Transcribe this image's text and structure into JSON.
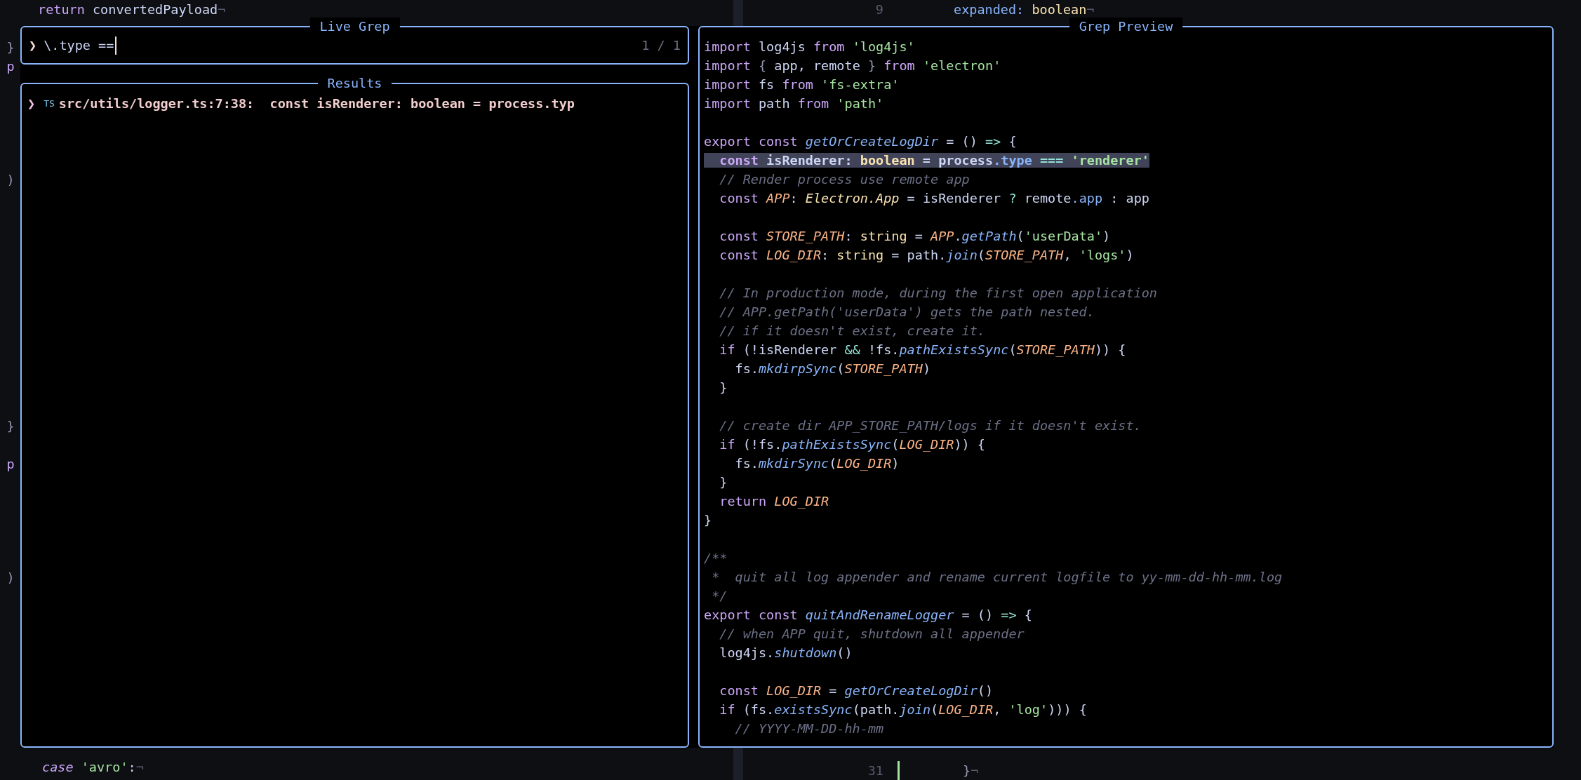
{
  "editor": {
    "top_left_line": [
      {
        "kind": "keyword",
        "text": "return"
      },
      {
        "kind": "plain",
        "text": " convertedPayload"
      },
      {
        "kind": "eol",
        "text": "¬"
      }
    ],
    "top_right_line": {
      "number": "9",
      "tokens": [
        {
          "kind": "property",
          "text": "expanded: "
        },
        {
          "kind": "type",
          "text": "boolean"
        },
        {
          "kind": "eol",
          "text": "¬"
        }
      ]
    },
    "left_edge_glyphs": [
      {
        "text": "}",
        "kind": "punct"
      },
      {
        "text": "p",
        "kind": "keyword"
      },
      {
        "text": ")",
        "kind": "punct"
      },
      {
        "text": "}",
        "kind": "punct"
      },
      {
        "text": "p",
        "kind": "keyword"
      },
      {
        "text": ")",
        "kind": "punct"
      }
    ],
    "bottom_left_line": [
      {
        "kind": "keyword-italic",
        "text": "case "
      },
      {
        "kind": "string",
        "text": "'avro'"
      },
      {
        "kind": "plain",
        "text": ":"
      },
      {
        "kind": "eol",
        "text": "¬"
      }
    ],
    "bottom_right_line": {
      "number": "31",
      "tokens": [
        {
          "kind": "punct",
          "text": "}"
        },
        {
          "kind": "eol",
          "text": "¬"
        }
      ]
    }
  },
  "prompt": {
    "title": "Live Grep",
    "caret": "❯",
    "value": "\\.type ==",
    "counter": "1 / 1"
  },
  "results": {
    "title": "Results",
    "items": [
      {
        "selected": true,
        "caret": "❯",
        "filetype": "TS",
        "path": "src/utils/logger.ts:7:38:",
        "text": "  const isRenderer: boolean = process.typ"
      }
    ]
  },
  "preview": {
    "title": "Grep Preview",
    "lines": [
      {
        "selected": false,
        "tokens": [
          {
            "kind": "keyword",
            "text": "import"
          },
          {
            "kind": "plain",
            "text": " log4js "
          },
          {
            "kind": "keyword",
            "text": "from "
          },
          {
            "kind": "string",
            "text": "'log4js'"
          }
        ]
      },
      {
        "selected": false,
        "tokens": [
          {
            "kind": "keyword",
            "text": "import"
          },
          {
            "kind": "punct",
            "text": " { "
          },
          {
            "kind": "plain",
            "text": "app, remote"
          },
          {
            "kind": "punct",
            "text": " } "
          },
          {
            "kind": "keyword",
            "text": "from "
          },
          {
            "kind": "string",
            "text": "'electron'"
          }
        ]
      },
      {
        "selected": false,
        "tokens": [
          {
            "kind": "keyword",
            "text": "import"
          },
          {
            "kind": "plain",
            "text": " fs "
          },
          {
            "kind": "keyword",
            "text": "from "
          },
          {
            "kind": "string",
            "text": "'fs-extra'"
          }
        ]
      },
      {
        "selected": false,
        "tokens": [
          {
            "kind": "keyword",
            "text": "import"
          },
          {
            "kind": "plain",
            "text": " path "
          },
          {
            "kind": "keyword",
            "text": "from "
          },
          {
            "kind": "string",
            "text": "'path'"
          }
        ]
      },
      {
        "selected": false
      },
      {
        "selected": false,
        "tokens": [
          {
            "kind": "keyword",
            "text": "export const "
          },
          {
            "kind": "function",
            "text": "getOrCreateLogDir"
          },
          {
            "kind": "plain",
            "text": " = () "
          },
          {
            "kind": "operator",
            "text": "=>"
          },
          {
            "kind": "plain",
            "text": " {"
          }
        ]
      },
      {
        "selected": true,
        "tokens": [
          {
            "kind": "keyword",
            "text": "  const"
          },
          {
            "kind": "plain",
            "text": " isRenderer: "
          },
          {
            "kind": "type",
            "text": "boolean"
          },
          {
            "kind": "plain",
            "text": " = process"
          },
          {
            "kind": "property",
            "text": ".type "
          },
          {
            "kind": "operator",
            "text": "=== "
          },
          {
            "kind": "string",
            "text": "'renderer'"
          }
        ]
      },
      {
        "selected": false,
        "tokens": [
          {
            "kind": "comment",
            "text": "  // Render process use remote app"
          }
        ]
      },
      {
        "selected": false,
        "tokens": [
          {
            "kind": "keyword",
            "text": "  const "
          },
          {
            "kind": "constant",
            "text": "APP"
          },
          {
            "kind": "plain",
            "text": ": "
          },
          {
            "kind": "type-italic",
            "text": "Electron.App"
          },
          {
            "kind": "plain",
            "text": " = isRenderer "
          },
          {
            "kind": "operator",
            "text": "?"
          },
          {
            "kind": "plain",
            "text": " remote"
          },
          {
            "kind": "property",
            "text": ".app"
          },
          {
            "kind": "plain",
            "text": " : app"
          }
        ]
      },
      {
        "selected": false
      },
      {
        "selected": false,
        "tokens": [
          {
            "kind": "keyword",
            "text": "  const "
          },
          {
            "kind": "constant",
            "text": "STORE_PATH"
          },
          {
            "kind": "plain",
            "text": ": "
          },
          {
            "kind": "type",
            "text": "string"
          },
          {
            "kind": "plain",
            "text": " = "
          },
          {
            "kind": "constant",
            "text": "APP"
          },
          {
            "kind": "plain",
            "text": "."
          },
          {
            "kind": "function",
            "text": "getPath"
          },
          {
            "kind": "plain",
            "text": "("
          },
          {
            "kind": "string",
            "text": "'userData'"
          },
          {
            "kind": "plain",
            "text": ")"
          }
        ]
      },
      {
        "selected": false,
        "tokens": [
          {
            "kind": "keyword",
            "text": "  const "
          },
          {
            "kind": "constant",
            "text": "LOG_DIR"
          },
          {
            "kind": "plain",
            "text": ": "
          },
          {
            "kind": "type",
            "text": "string"
          },
          {
            "kind": "plain",
            "text": " = path."
          },
          {
            "kind": "function",
            "text": "join"
          },
          {
            "kind": "plain",
            "text": "("
          },
          {
            "kind": "constant",
            "text": "STORE_PATH"
          },
          {
            "kind": "plain",
            "text": ", "
          },
          {
            "kind": "string",
            "text": "'logs'"
          },
          {
            "kind": "plain",
            "text": ")"
          }
        ]
      },
      {
        "selected": false
      },
      {
        "selected": false,
        "tokens": [
          {
            "kind": "comment",
            "text": "  // In production mode, during the first open application"
          }
        ]
      },
      {
        "selected": false,
        "tokens": [
          {
            "kind": "comment",
            "text": "  // APP.getPath('userData') gets the path nested."
          }
        ]
      },
      {
        "selected": false,
        "tokens": [
          {
            "kind": "comment",
            "text": "  // if it doesn't exist, create it."
          }
        ]
      },
      {
        "selected": false,
        "tokens": [
          {
            "kind": "keyword",
            "text": "  if"
          },
          {
            "kind": "plain",
            "text": " (!isRenderer "
          },
          {
            "kind": "operator",
            "text": "&&"
          },
          {
            "kind": "plain",
            "text": " !fs."
          },
          {
            "kind": "function",
            "text": "pathExistsSync"
          },
          {
            "kind": "plain",
            "text": "("
          },
          {
            "kind": "constant",
            "text": "STORE_PATH"
          },
          {
            "kind": "plain",
            "text": ")) {"
          }
        ]
      },
      {
        "selected": false,
        "tokens": [
          {
            "kind": "plain",
            "text": "    fs."
          },
          {
            "kind": "function",
            "text": "mkdirpSync"
          },
          {
            "kind": "plain",
            "text": "("
          },
          {
            "kind": "constant",
            "text": "STORE_PATH"
          },
          {
            "kind": "plain",
            "text": ")"
          }
        ]
      },
      {
        "selected": false,
        "tokens": [
          {
            "kind": "plain",
            "text": "  }"
          }
        ]
      },
      {
        "selected": false
      },
      {
        "selected": false,
        "tokens": [
          {
            "kind": "comment",
            "text": "  // create dir APP_STORE_PATH/logs if it doesn't exist."
          }
        ]
      },
      {
        "selected": false,
        "tokens": [
          {
            "kind": "keyword",
            "text": "  if"
          },
          {
            "kind": "plain",
            "text": " (!fs."
          },
          {
            "kind": "function",
            "text": "pathExistsSync"
          },
          {
            "kind": "plain",
            "text": "("
          },
          {
            "kind": "constant",
            "text": "LOG_DIR"
          },
          {
            "kind": "plain",
            "text": ")) {"
          }
        ]
      },
      {
        "selected": false,
        "tokens": [
          {
            "kind": "plain",
            "text": "    fs."
          },
          {
            "kind": "function",
            "text": "mkdirSync"
          },
          {
            "kind": "plain",
            "text": "("
          },
          {
            "kind": "constant",
            "text": "LOG_DIR"
          },
          {
            "kind": "plain",
            "text": ")"
          }
        ]
      },
      {
        "selected": false,
        "tokens": [
          {
            "kind": "plain",
            "text": "  }"
          }
        ]
      },
      {
        "selected": false,
        "tokens": [
          {
            "kind": "keyword",
            "text": "  return "
          },
          {
            "kind": "constant",
            "text": "LOG_DIR"
          }
        ]
      },
      {
        "selected": false,
        "tokens": [
          {
            "kind": "plain",
            "text": "}"
          }
        ]
      },
      {
        "selected": false
      },
      {
        "selected": false,
        "tokens": [
          {
            "kind": "comment",
            "text": "/**"
          }
        ]
      },
      {
        "selected": false,
        "tokens": [
          {
            "kind": "comment",
            "text": " *  quit all log appender and rename current logfile to yy-mm-dd-hh-mm.log"
          }
        ]
      },
      {
        "selected": false,
        "tokens": [
          {
            "kind": "comment",
            "text": " */"
          }
        ]
      },
      {
        "selected": false,
        "tokens": [
          {
            "kind": "keyword",
            "text": "export const "
          },
          {
            "kind": "function",
            "text": "quitAndRenameLogger"
          },
          {
            "kind": "plain",
            "text": " = () "
          },
          {
            "kind": "operator",
            "text": "=>"
          },
          {
            "kind": "plain",
            "text": " {"
          }
        ]
      },
      {
        "selected": false,
        "tokens": [
          {
            "kind": "comment",
            "text": "  // when APP quit, shutdown all appender"
          }
        ]
      },
      {
        "selected": false,
        "tokens": [
          {
            "kind": "plain",
            "text": "  log4js."
          },
          {
            "kind": "function",
            "text": "shutdown"
          },
          {
            "kind": "plain",
            "text": "()"
          }
        ]
      },
      {
        "selected": false
      },
      {
        "selected": false,
        "tokens": [
          {
            "kind": "keyword",
            "text": "  const "
          },
          {
            "kind": "constant",
            "text": "LOG_DIR"
          },
          {
            "kind": "plain",
            "text": " = "
          },
          {
            "kind": "function",
            "text": "getOrCreateLogDir"
          },
          {
            "kind": "plain",
            "text": "()"
          }
        ]
      },
      {
        "selected": false,
        "tokens": [
          {
            "kind": "keyword",
            "text": "  if"
          },
          {
            "kind": "plain",
            "text": " (fs."
          },
          {
            "kind": "function",
            "text": "existsSync"
          },
          {
            "kind": "plain",
            "text": "(path."
          },
          {
            "kind": "function",
            "text": "join"
          },
          {
            "kind": "plain",
            "text": "("
          },
          {
            "kind": "constant",
            "text": "LOG_DIR"
          },
          {
            "kind": "plain",
            "text": ", "
          },
          {
            "kind": "string",
            "text": "'log'"
          },
          {
            "kind": "plain",
            "text": "))) {"
          }
        ]
      },
      {
        "selected": false,
        "tokens": [
          {
            "kind": "comment",
            "text": "    // YYYY-MM-DD-hh-mm"
          }
        ]
      }
    ]
  }
}
